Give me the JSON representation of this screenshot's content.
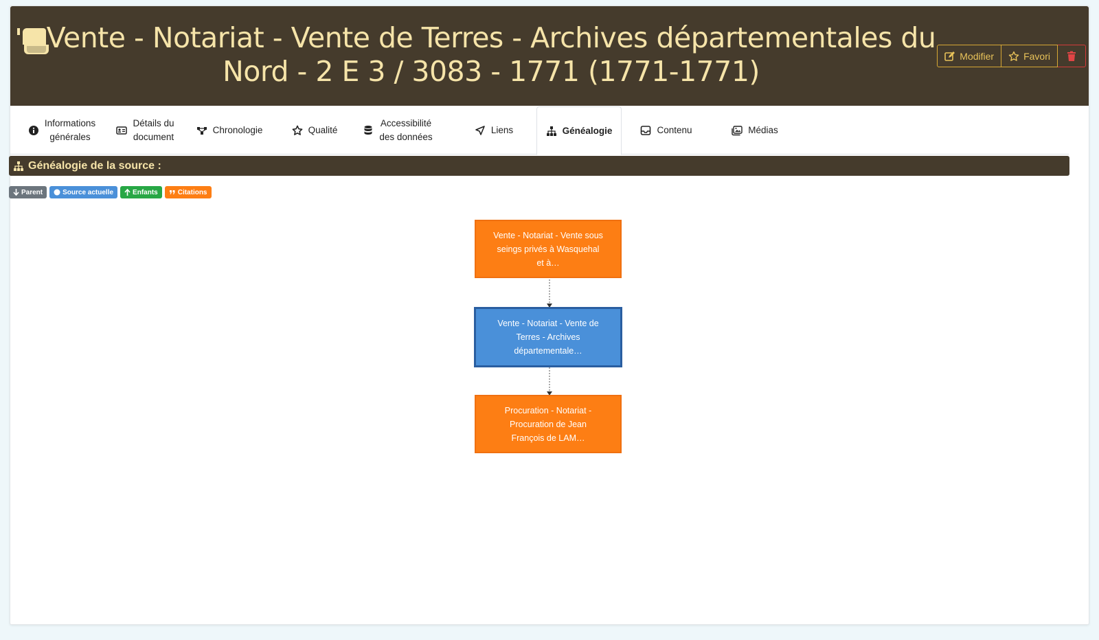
{
  "header": {
    "title": "Vente - Notariat - Vente de Terres - Archives départementales du Nord - 2 E 3 / 3083 - 1771 (1771-1771)",
    "icon": "scroll-icon",
    "actions": {
      "edit_label": "Modifier",
      "favorite_label": "Favori",
      "delete_icon": "trash-icon"
    }
  },
  "tabs": [
    {
      "label": "Informations\ngénérales",
      "icon": "info-circle-icon"
    },
    {
      "label": "Détails du\ndocument",
      "icon": "id-card-icon"
    },
    {
      "label": "Chronologie",
      "icon": "timeline-icon"
    },
    {
      "label": "Qualité",
      "icon": "star-icon"
    },
    {
      "label": "Accessibilité\ndes données",
      "icon": "database-icon"
    },
    {
      "label": "Liens",
      "icon": "location-arrow-icon"
    },
    {
      "label": "Généalogie",
      "icon": "sitemap-icon",
      "active": true
    },
    {
      "label": "Contenu",
      "icon": "inbox-icon"
    },
    {
      "label": "Médias",
      "icon": "images-icon"
    }
  ],
  "section": {
    "title": "Généalogie de la source :",
    "icon": "sitemap-icon"
  },
  "legend": {
    "parent": "Parent",
    "current": "Source actuelle",
    "children": "Enfants",
    "citations": "Citations"
  },
  "nodes": {
    "parent": "Vente - Notariat - Vente sous seings privés à Wasquehal et à…",
    "current": "Vente - Notariat - Vente de Terres - Archives départementale…",
    "child": "Procuration - Notariat - Procuration de Jean François de LAM…"
  },
  "colors": {
    "header_bg": "#453b2c",
    "title_text": "#f6e4a9",
    "accent": "#d7a835",
    "danger": "#d33b3b",
    "node_orange": "#fd7e14",
    "node_blue": "#4a90d9"
  }
}
